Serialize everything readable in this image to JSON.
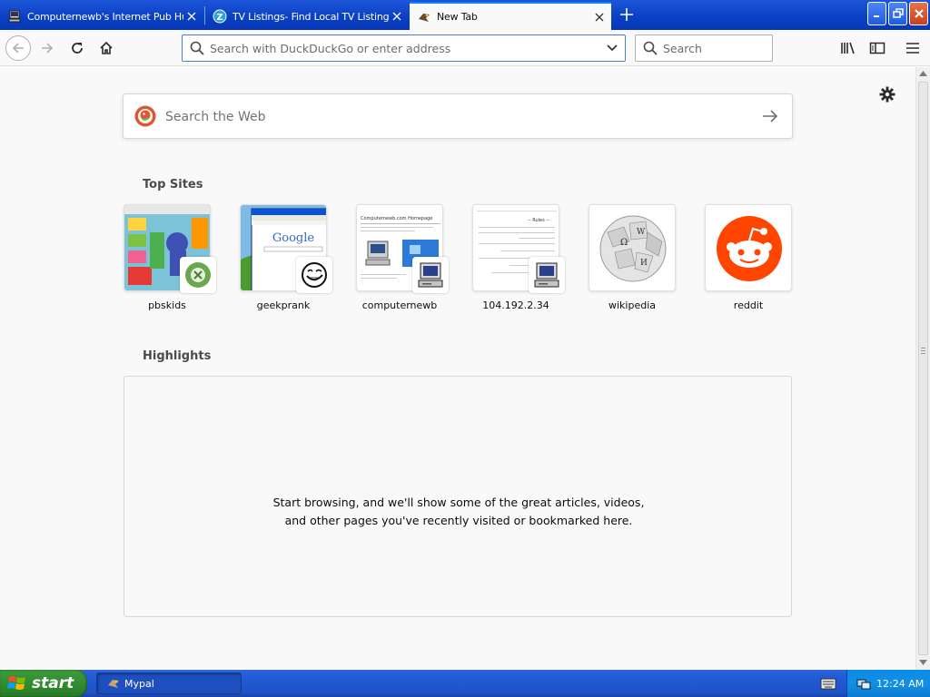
{
  "tabs": [
    {
      "title": "Computernewb's Internet Pub Hub",
      "favicon": "computer-favicon",
      "selected": false
    },
    {
      "title": "TV Listings- Find Local TV Listings a",
      "favicon": "z-favicon",
      "selected": false
    },
    {
      "title": "New Tab",
      "favicon": "mypal-favicon",
      "selected": true
    }
  ],
  "navbar": {
    "url_placeholder": "Search with DuckDuckGo or enter address",
    "search_placeholder": "Search"
  },
  "newtab": {
    "web_search_placeholder": "Search the Web",
    "top_sites_title": "Top Sites",
    "top_sites": [
      {
        "label": "pbskids"
      },
      {
        "label": "geekprank"
      },
      {
        "label": "computernewb"
      },
      {
        "label": "104.192.2.34"
      },
      {
        "label": "wikipedia"
      },
      {
        "label": "reddit"
      }
    ],
    "highlights_title": "Highlights",
    "highlights_empty": "Start browsing, and we'll show some of the great articles, videos, and other pages you've recently visited or bookmarked here.",
    "thumb_texts": {
      "google": "Google",
      "computernewb_header": "Computernewb.com Homepage",
      "rules": "-- Rules --"
    }
  },
  "taskbar": {
    "start_label": "start",
    "task_label": "Mypal",
    "clock": "12:24 AM"
  },
  "colors": {
    "reddit": "#ff4500",
    "accent": "#0a84ff",
    "xp_blue": "#245edb",
    "start_green": "#2f8a2f"
  }
}
